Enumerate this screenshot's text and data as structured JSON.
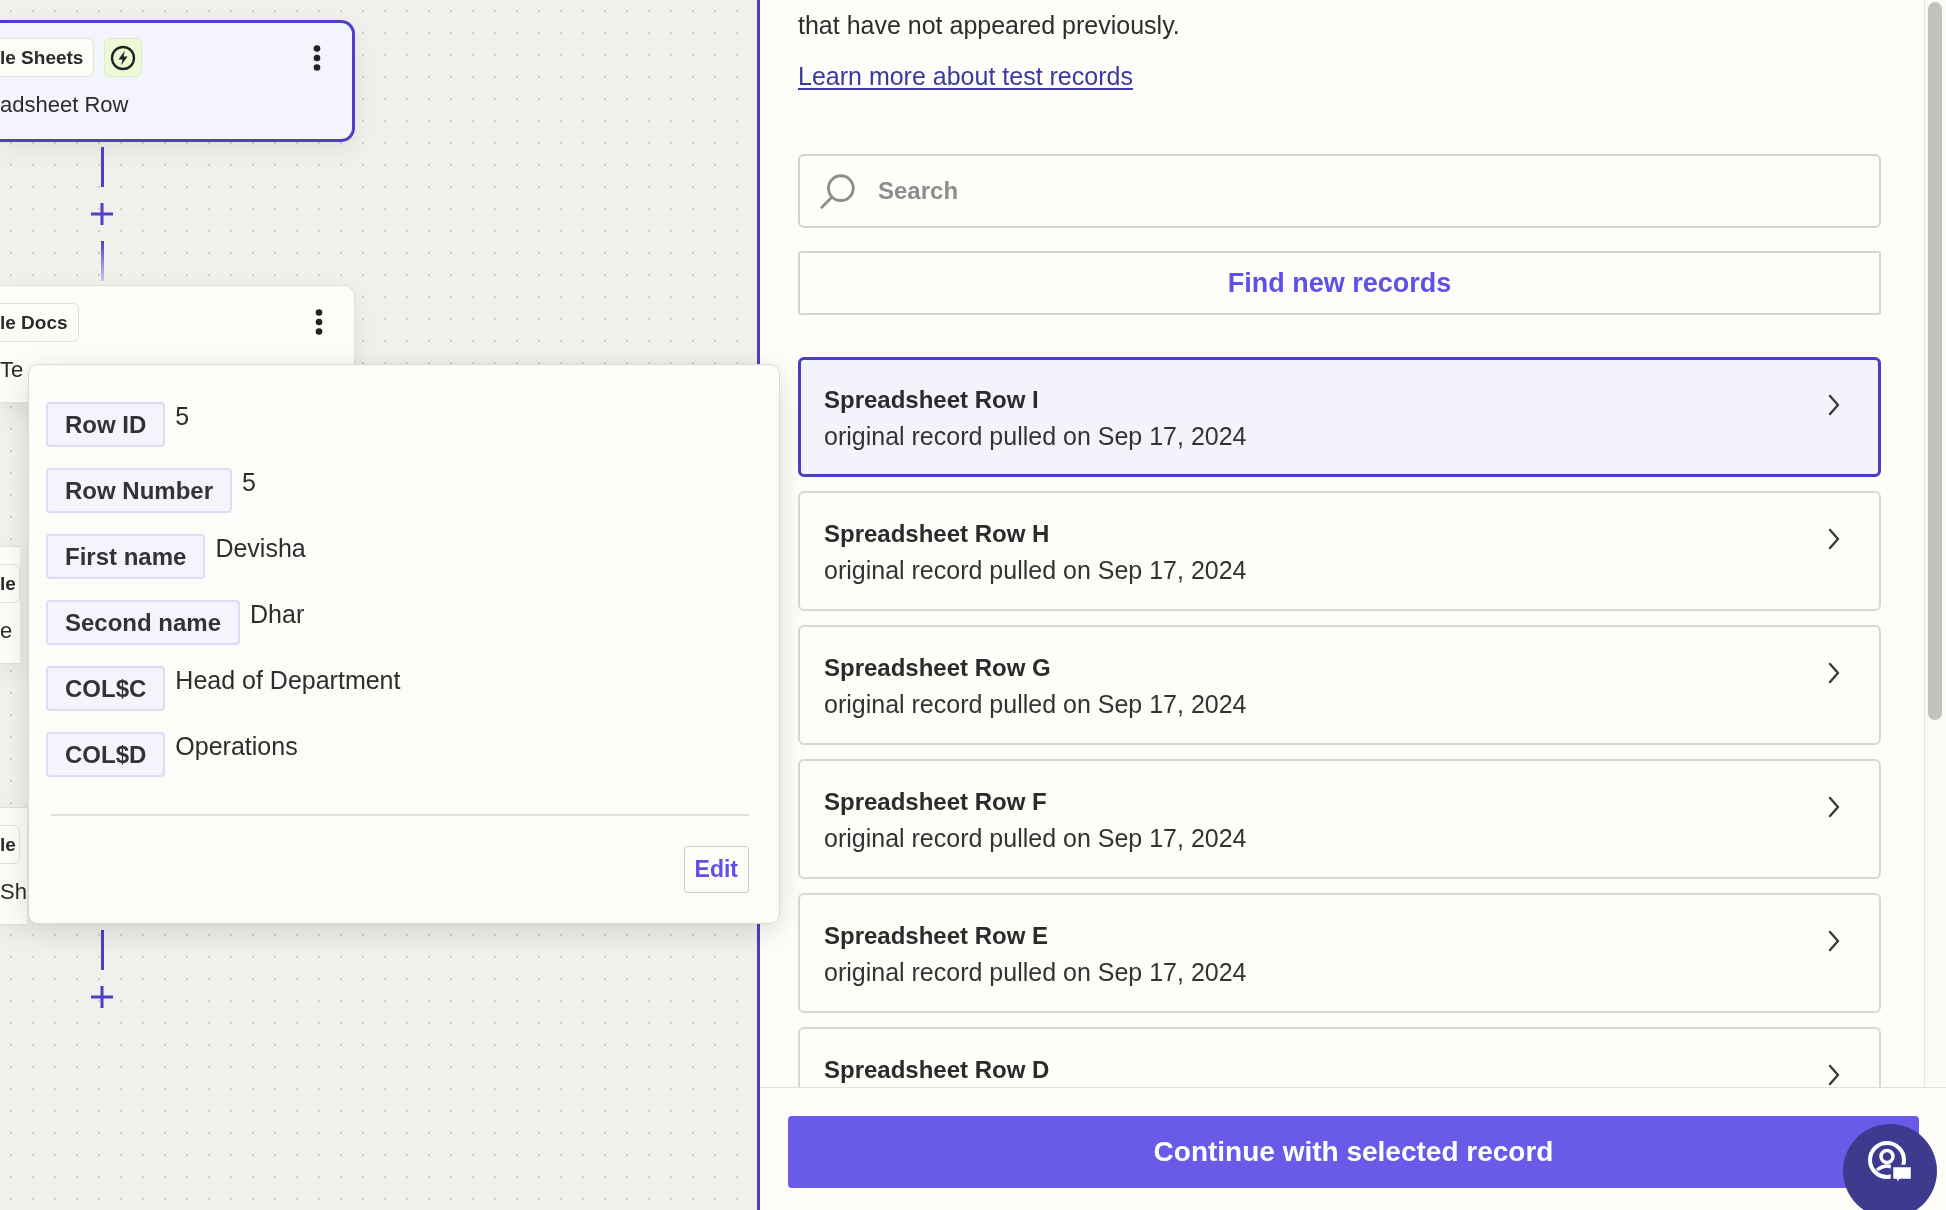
{
  "canvas": {
    "steps": [
      {
        "kind": "trigger",
        "app_tag": "le Sheets",
        "title": "adsheet Row",
        "selected": true,
        "menu_button": true,
        "add_step_button": true
      },
      {
        "kind": "action",
        "app_tag": "le Docs",
        "title": "Te",
        "selected": false,
        "menu_button": true,
        "add_step_button": false
      },
      {
        "kind": "action",
        "app_tag": "le",
        "title": "e",
        "selected": false,
        "menu_button": false,
        "add_step_button": false
      },
      {
        "kind": "action",
        "app_tag": "le",
        "title": "Sh",
        "selected": false,
        "menu_button": false,
        "add_step_button": true
      }
    ]
  },
  "record_popup": {
    "fields": [
      {
        "label": "Row ID",
        "value": "5"
      },
      {
        "label": "Row Number",
        "value": "5"
      },
      {
        "label": "First name",
        "value": "Devisha"
      },
      {
        "label": "Second name",
        "value": "Dhar"
      },
      {
        "label": "COL$C",
        "value": "Head of Department"
      },
      {
        "label": "COL$D",
        "value": "Operations"
      }
    ],
    "edit_button": "Edit"
  },
  "panel": {
    "intro": "that have not appeared previously.",
    "help_link": "Learn more about test records",
    "search": {
      "placeholder": "Search"
    },
    "find_button": "Find new records",
    "records": [
      {
        "title": "Spreadsheet Row I",
        "subtitle": "original record pulled on Sep 17, 2024",
        "selected": true
      },
      {
        "title": "Spreadsheet Row H",
        "subtitle": "original record pulled on Sep 17, 2024",
        "selected": false
      },
      {
        "title": "Spreadsheet Row G",
        "subtitle": "original record pulled on Sep 17, 2024",
        "selected": false
      },
      {
        "title": "Spreadsheet Row F",
        "subtitle": "original record pulled on Sep 17, 2024",
        "selected": false
      },
      {
        "title": "Spreadsheet Row E",
        "subtitle": "original record pulled on Sep 17, 2024",
        "selected": false
      },
      {
        "title": "Spreadsheet Row D",
        "selected": false
      }
    ],
    "continue_button": "Continue with selected record"
  }
}
